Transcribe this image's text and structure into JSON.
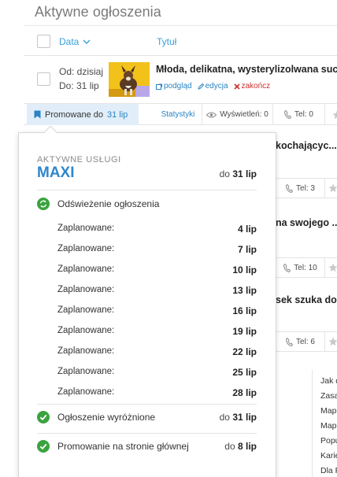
{
  "page": {
    "title": "Aktywne ogłoszenia"
  },
  "columns": {
    "date": "Data",
    "title": "Tytuł"
  },
  "listing": {
    "from": "Od: dzisiaj",
    "to": "Do: 31 lip",
    "title": "Młoda, delikatna, wysterylizolwana suczk...",
    "actions": {
      "preview": "podgląd",
      "edit": "edycja",
      "end": "zakończ"
    }
  },
  "strip": {
    "promo_prefix": "Promowane do",
    "promo_date": "31 lip",
    "stats": "Statystyki",
    "views": "Wyświetleń: 0",
    "tel": "Tel: 0"
  },
  "background_rows": [
    {
      "title": "kochającyc...",
      "tel": "Tel: 3"
    },
    {
      "title": "na swojego ...",
      "tel": "Tel: 10"
    },
    {
      "title": "sek szuka do...",
      "tel": "Tel: 6"
    }
  ],
  "side_menu": [
    "Jak d",
    "Zasa",
    "Map",
    "Map",
    "Popu",
    "Karie",
    "Dla F"
  ],
  "popover": {
    "label": "AKTYWNE USŁUGI",
    "package": "MAXI",
    "until_prefix": "do",
    "until_date": "31 lip",
    "refresh": {
      "name": "Odświeżenie ogłoszenia"
    },
    "schedule": [
      {
        "label": "Zaplanowane:",
        "date": "4 lip"
      },
      {
        "label": "Zaplanowane:",
        "date": "7 lip"
      },
      {
        "label": "Zaplanowane:",
        "date": "10 lip"
      },
      {
        "label": "Zaplanowane:",
        "date": "13 lip"
      },
      {
        "label": "Zaplanowane:",
        "date": "16 lip"
      },
      {
        "label": "Zaplanowane:",
        "date": "19 lip"
      },
      {
        "label": "Zaplanowane:",
        "date": "22 lip"
      },
      {
        "label": "Zaplanowane:",
        "date": "25 lip"
      },
      {
        "label": "Zaplanowane:",
        "date": "28 lip"
      }
    ],
    "featured": {
      "name": "Ogłoszenie wyróżnione",
      "prefix": "do",
      "date": "31 lip"
    },
    "homepage": {
      "name": "Promowanie na stronie głównej",
      "prefix": "do",
      "date": "8 lip"
    }
  },
  "colors": {
    "accent": "#2f86cc",
    "link": "#3aa0d8",
    "green": "#3aa33f",
    "danger": "#c9302c"
  }
}
